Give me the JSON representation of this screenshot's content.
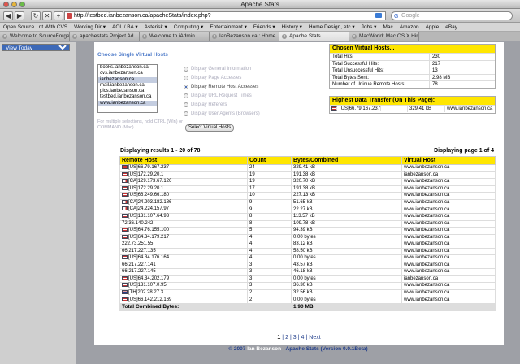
{
  "window": {
    "title": "Apache Stats"
  },
  "nav": {
    "url": "http://testbed.ianbezanson.ca/apacheStats/index.php?",
    "search_placeholder": "Google"
  },
  "bookmarks": [
    "Open Source ..nt With CVS",
    "Working Dir ▾",
    "AOL / BA ▾",
    "Asterisk ▾",
    "Computing ▾",
    "Entertainment ▾",
    "Friends ▾",
    "History ▾",
    "Home Design, etc ▾",
    "Jobs ▾",
    "Mac",
    "Amazon",
    "Apple",
    "eBay"
  ],
  "tabs": [
    "Welcome to SourceForge",
    "apachestats Project Ad...",
    "Welcome to iAdmin",
    "IanBezanson.ca : Home",
    "Apache Stats",
    "MacWorld: Mac OS X Hin..."
  ],
  "sidebar": {
    "select_value": "View Today"
  },
  "vhosts": {
    "title": "Choose Single Virtual Hosts",
    "items": [
      "books.ianbezanson.ca",
      "cvs.ianbezanson.ca",
      "ianbezanson.ca",
      "mail.ianbezanson.ca",
      "pics.ianbezanson.ca",
      "testbed.ianbezanson.ca",
      "www.ianbezanson.ca"
    ],
    "note": "For multiple selections, hold CTRL (Win) or COMMAND (Mac)",
    "options": [
      "Display General Information",
      "Display Page Accesses",
      "Display Remote Host Accesses",
      "Display URL Request Times",
      "Display Referers",
      "Display User Agents (Browsers)"
    ],
    "button": "Select Virtual Hosts"
  },
  "chosen": {
    "title": "Chosen Virtual Hosts...",
    "rows": [
      {
        "label": "Total Hits:",
        "value": "230"
      },
      {
        "label": "Total Successful Hits:",
        "value": "217"
      },
      {
        "label": "Total Unsuccessful Hits:",
        "value": "13"
      },
      {
        "label": "Total Bytes Sent:",
        "value": "2.98 MB"
      },
      {
        "label": "Number of Unique Remote Hosts:",
        "value": "78"
      }
    ]
  },
  "highest": {
    "title": "Highest Data Transfer (On This Page):",
    "host": "[US]66.79.167.237",
    "bytes": "329.41 kB",
    "vhost": "www.ianbezanson.ca"
  },
  "results": {
    "left": "Displaying results 1 - 20 of 78",
    "right": "Displaying page 1 of 4",
    "headers": [
      "Remote Host",
      "Count",
      "Bytes/Combined",
      "Virtual Host"
    ],
    "rows": [
      {
        "flag": "us",
        "host": "[US]66.79.167.237",
        "count": "24",
        "bytes": "329.41 kB",
        "vhost": "www.ianbezanson.ca"
      },
      {
        "flag": "us",
        "host": "[US]172.29.20.1",
        "count": "19",
        "bytes": "191.38 kB",
        "vhost": "ianbezanson.ca"
      },
      {
        "flag": "ca",
        "host": "[CA]129.173.67.126",
        "count": "19",
        "bytes": "320.70 kB",
        "vhost": "www.ianbezanson.ca"
      },
      {
        "flag": "us",
        "host": "[US]172.29.20.1",
        "count": "17",
        "bytes": "191.38 kB",
        "vhost": "www.ianbezanson.ca"
      },
      {
        "flag": "us",
        "host": "[US]66.249.66.180",
        "count": "10",
        "bytes": "227.13 kB",
        "vhost": "www.ianbezanson.ca"
      },
      {
        "flag": "ca",
        "host": "[CA]24.203.182.186",
        "count": "9",
        "bytes": "51.65 kB",
        "vhost": "www.ianbezanson.ca"
      },
      {
        "flag": "ca",
        "host": "[CA]24.224.157.97",
        "count": "9",
        "bytes": "22.27 kB",
        "vhost": "www.ianbezanson.ca"
      },
      {
        "flag": "us",
        "host": "[US]131.107.64.93",
        "count": "8",
        "bytes": "113.57 kB",
        "vhost": "www.ianbezanson.ca"
      },
      {
        "flag": "",
        "host": "72.36.140.242",
        "count": "8",
        "bytes": "109.78 kB",
        "vhost": "www.ianbezanson.ca"
      },
      {
        "flag": "us",
        "host": "[US]64.76.155.100",
        "count": "5",
        "bytes": "94.39 kB",
        "vhost": "www.ianbezanson.ca"
      },
      {
        "flag": "us",
        "host": "[US]64.34.179.217",
        "count": "4",
        "bytes": "0.00 bytes",
        "vhost": "www.ianbezanson.ca"
      },
      {
        "flag": "",
        "host": "222.73.251.55",
        "count": "4",
        "bytes": "83.12 kB",
        "vhost": "www.ianbezanson.ca"
      },
      {
        "flag": "",
        "host": "66.217.227.135",
        "count": "4",
        "bytes": "58.50 kB",
        "vhost": "www.ianbezanson.ca"
      },
      {
        "flag": "us",
        "host": "[US]64.34.176.164",
        "count": "4",
        "bytes": "0.00 bytes",
        "vhost": "www.ianbezanson.ca"
      },
      {
        "flag": "",
        "host": "66.217.227.141",
        "count": "3",
        "bytes": "43.57 kB",
        "vhost": "www.ianbezanson.ca"
      },
      {
        "flag": "",
        "host": "66.217.227.145",
        "count": "3",
        "bytes": "46.18 kB",
        "vhost": "www.ianbezanson.ca"
      },
      {
        "flag": "us",
        "host": "[US]64.34.202.179",
        "count": "3",
        "bytes": "0.00 bytes",
        "vhost": "ianbezanson.ca"
      },
      {
        "flag": "us",
        "host": "[US]131.107.0.95",
        "count": "3",
        "bytes": "36.30 kB",
        "vhost": "www.ianbezanson.ca"
      },
      {
        "flag": "th",
        "host": "[TH]202.28.27.3",
        "count": "2",
        "bytes": "32.56 kB",
        "vhost": "www.ianbezanson.ca"
      },
      {
        "flag": "us",
        "host": "[US]66.142.212.169",
        "count": "2",
        "bytes": "0.00 bytes",
        "vhost": "www.ianbezanson.ca"
      }
    ],
    "total_label": "Total Combined Bytes:",
    "total_value": "1.90 MB"
  },
  "pager": {
    "pages": [
      "1",
      "2",
      "3",
      "4"
    ],
    "current": "1",
    "next": "Next"
  },
  "footer": {
    "copy": "© 2007",
    "name": "Ian Bezanson",
    "app": "Apache Stats (Version 0.0.1Beta)"
  }
}
